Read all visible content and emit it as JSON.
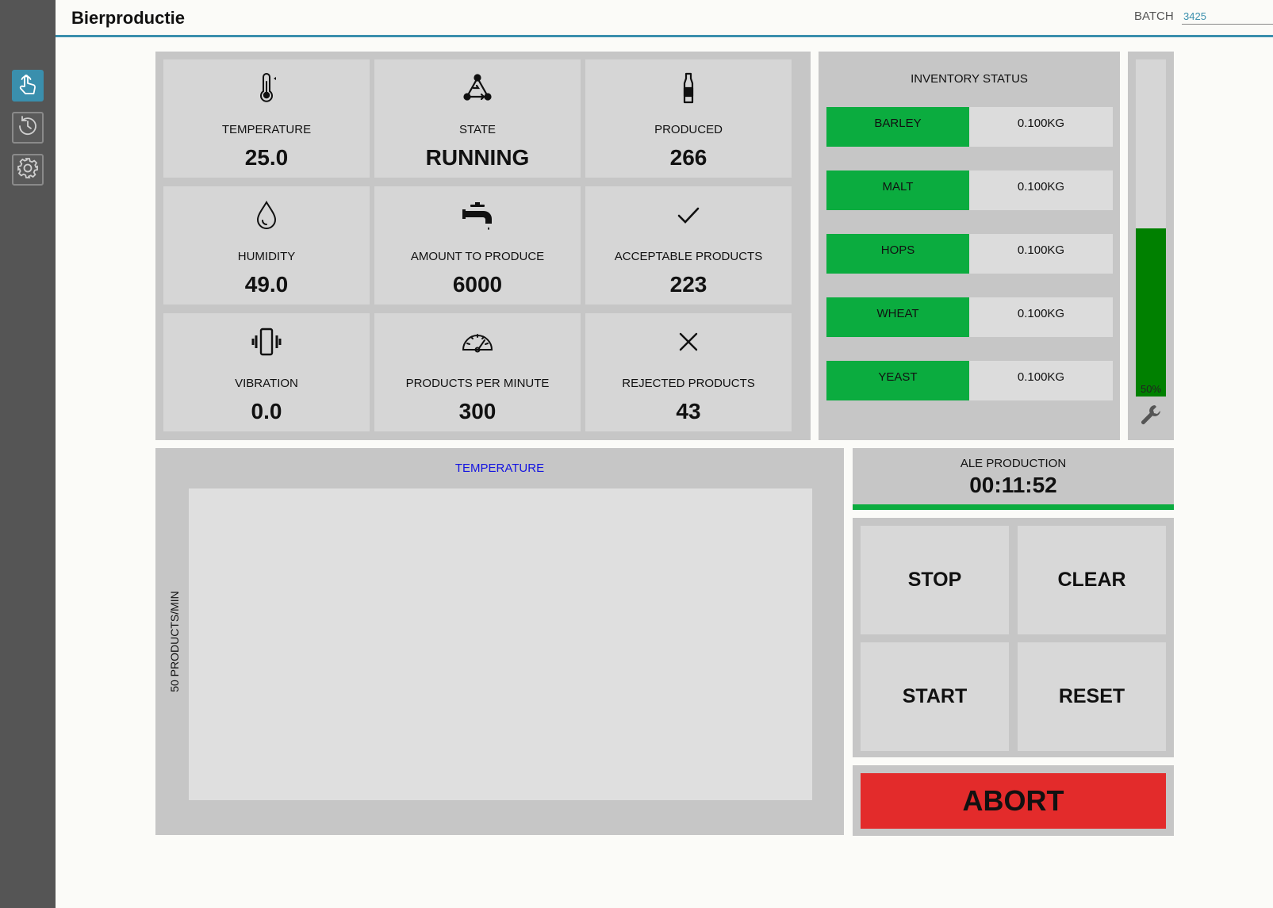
{
  "header": {
    "title": "Bierproductie",
    "batch_label": "BATCH",
    "batch_value": "3425",
    "batch_caret": "▾"
  },
  "nav": {
    "items": [
      {
        "icon": "touch-icon",
        "active": true
      },
      {
        "icon": "history-icon",
        "active": false
      },
      {
        "icon": "settings-icon",
        "active": false
      }
    ]
  },
  "metrics": [
    {
      "label": "TEMPERATURE",
      "value": "25.0",
      "icon": "thermometer-icon",
      "active": true
    },
    {
      "label": "STATE",
      "value": "RUNNING",
      "icon": "state-network-icon",
      "active": false
    },
    {
      "label": "PRODUCED",
      "value": "266",
      "icon": "bottle-icon",
      "active": false
    },
    {
      "label": "HUMIDITY",
      "value": "49.0",
      "icon": "droplet-icon",
      "active": false
    },
    {
      "label": "AMOUNT TO PRODUCE",
      "value": "6000",
      "icon": "faucet-icon",
      "active": false
    },
    {
      "label": "ACCEPTABLE PRODUCTS",
      "value": "223",
      "icon": "checkmark-icon",
      "active": false
    },
    {
      "label": "VIBRATION",
      "value": "0.0",
      "icon": "vibration-icon",
      "active": false
    },
    {
      "label": "PRODUCTS PER MINUTE",
      "value": "300",
      "icon": "speedometer-icon",
      "active": false
    },
    {
      "label": "REJECTED PRODUCTS",
      "value": "43",
      "icon": "cross-icon",
      "active": false
    }
  ],
  "inventory": {
    "title": "INVENTORY STATUS",
    "items": [
      {
        "name": "BARLEY",
        "amount": "0.100KG"
      },
      {
        "name": "MALT",
        "amount": "0.100KG"
      },
      {
        "name": "HOPS",
        "amount": "0.100KG"
      },
      {
        "name": "WHEAT",
        "amount": "0.100KG"
      },
      {
        "name": "YEAST",
        "amount": "0.100KG"
      }
    ]
  },
  "level": {
    "percent": 50,
    "label": "50%",
    "tool_icon": "wrench-icon"
  },
  "chart": {
    "title": "TEMPERATURE",
    "ylabel": "50 PRODUCTS/MIN"
  },
  "timer": {
    "label": "ALE PRODUCTION",
    "value": "00:11:52"
  },
  "controls": {
    "stop": "STOP",
    "clear": "CLEAR",
    "start": "START",
    "reset": "RESET",
    "abort": "ABORT"
  },
  "colors": {
    "accent": "#3a8fad",
    "inventory_ok": "#0bac3f",
    "level_fill": "#008000",
    "abort": "#e32b2b",
    "chart_title": "#1515e0"
  }
}
